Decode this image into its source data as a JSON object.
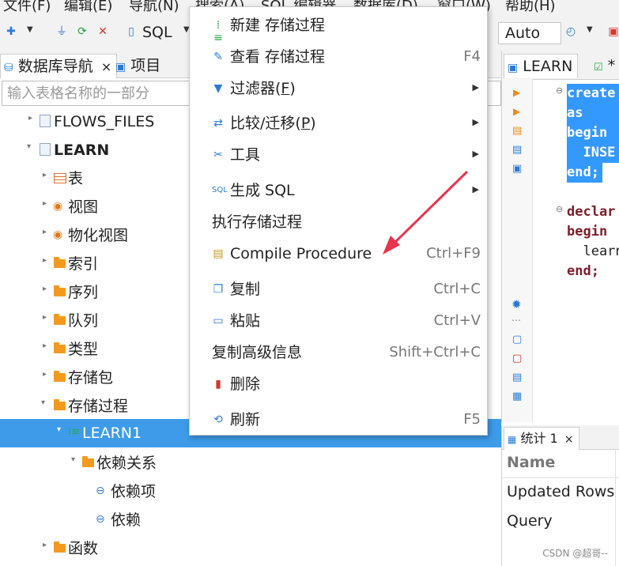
{
  "menubar": {
    "items": [
      "文件(F)",
      "编辑(E)",
      "导航(N)",
      "搜索(A)",
      "SQL 编辑器",
      "数据库(D)",
      "窗口(W)",
      "帮助(H)"
    ]
  },
  "toolbar": {
    "sql_label": "SQL",
    "mode_value": "Auto"
  },
  "navigator": {
    "tabs": [
      "数据库导航",
      "项目"
    ],
    "search_placeholder": "输入表格名称的一部分",
    "tree": [
      {
        "label": "FLOWS_FILES",
        "icon": "schema-icon"
      },
      {
        "label": "LEARN",
        "icon": "schema-icon"
      },
      {
        "label": "表",
        "icon": "table-icon"
      },
      {
        "label": "视图",
        "icon": "view-icon"
      },
      {
        "label": "物化视图",
        "icon": "view-icon"
      },
      {
        "label": "索引",
        "icon": "folder-icon"
      },
      {
        "label": "序列",
        "icon": "folder-icon"
      },
      {
        "label": "队列",
        "icon": "folder-icon"
      },
      {
        "label": "类型",
        "icon": "folder-icon"
      },
      {
        "label": "存储包",
        "icon": "folder-icon"
      },
      {
        "label": "存储过程",
        "icon": "folder-icon"
      },
      {
        "label": "LEARN1",
        "icon": "procedure-icon"
      },
      {
        "label": "依赖关系",
        "icon": "folder-icon"
      },
      {
        "label": "依赖项",
        "icon": "link-icon"
      },
      {
        "label": "依赖",
        "icon": "link-icon"
      },
      {
        "label": "函数",
        "icon": "folder-icon"
      }
    ]
  },
  "context_menu": {
    "items": [
      {
        "label": "新建 存储过程",
        "shortcut": "",
        "icon": "procedure-new-icon"
      },
      {
        "label": "查看 存储过程",
        "shortcut": "F4",
        "icon": "pencil-icon"
      },
      {
        "label_main": "过滤器(",
        "label_key": "F",
        "label_end": ")",
        "icon": "filter-icon"
      },
      {
        "label_main": "比较/迁移(",
        "label_key": "P",
        "label_end": ")",
        "icon": "compare-icon"
      },
      {
        "label": "工具",
        "icon": "tools-icon"
      },
      {
        "label": "生成 SQL",
        "icon": "sql-icon"
      },
      {
        "label": "执行存储过程"
      },
      {
        "label": "Compile Procedure",
        "shortcut": "Ctrl+F9",
        "icon": "compile-icon"
      },
      {
        "label": "复制",
        "shortcut": "Ctrl+C",
        "icon": "copy-icon"
      },
      {
        "label": "粘贴",
        "shortcut": "Ctrl+V",
        "icon": "paste-icon"
      },
      {
        "label": "复制高级信息",
        "shortcut": "Shift+Ctrl+C"
      },
      {
        "label": "删除",
        "icon": "delete-icon"
      },
      {
        "label": "刷新",
        "shortcut": "F5",
        "icon": "refresh-icon"
      }
    ]
  },
  "editor": {
    "tabs": [
      "LEARN",
      "*"
    ],
    "code_lines": [
      "create",
      "as",
      "begin",
      "  INSE",
      "end;",
      "",
      "declar",
      "begin",
      "  learn",
      "end;"
    ]
  },
  "stats": {
    "tab": "统计 1",
    "rows": [
      "Name",
      "Updated Rows",
      "Query"
    ]
  },
  "watermark": "CSDN @超哥--",
  "colors": {
    "selection": "#3d9be9",
    "folder": "#f39a1e",
    "keyword": "#7a1f2b",
    "code_highlight": "#3399ff",
    "arrow": "#e8344c"
  }
}
